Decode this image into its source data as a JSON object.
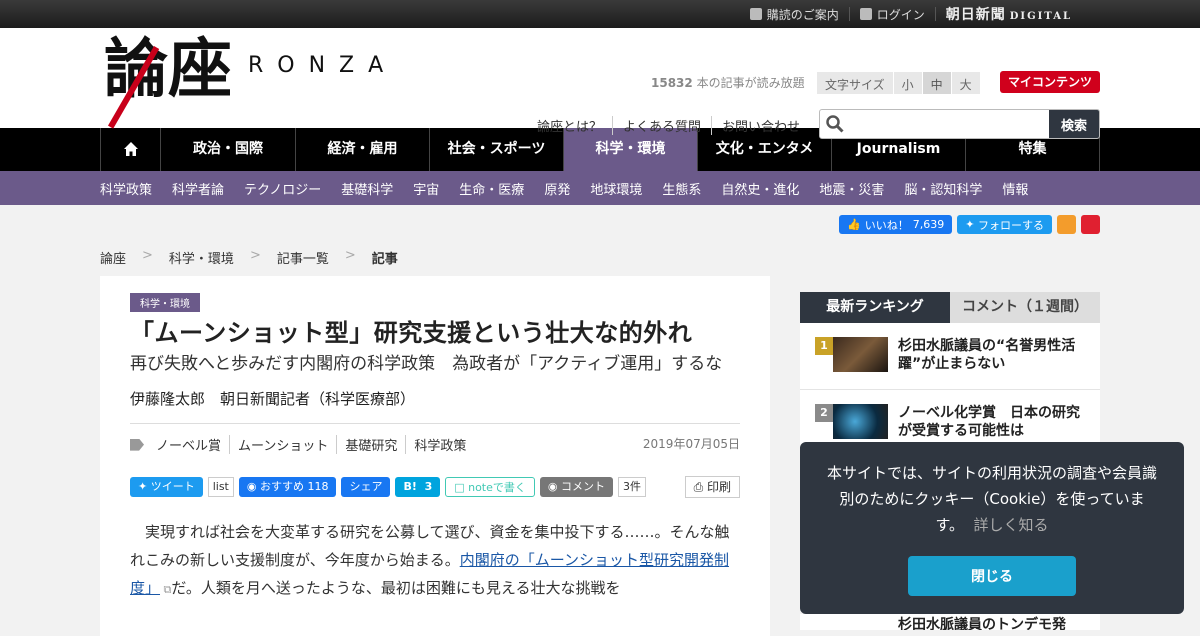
{
  "topbar": {
    "guide": "購読のご案内",
    "login": "ログイン",
    "brand": "朝日新聞",
    "brand_sub": "DIGITAL"
  },
  "header": {
    "logo_kanji": "論座",
    "logo_roman": "RONZA",
    "count_num": "15832",
    "count_text": " 本の記事が読み放題",
    "fontsize_label": "文字サイズ",
    "fontsize_small": "小",
    "fontsize_mid": "中",
    "fontsize_large": "大",
    "mycontent": "マイコンテンツ",
    "links": [
      "論座とは？",
      "よくある質問",
      "お問い合わせ"
    ],
    "search_button": "検索",
    "search_placeholder": ""
  },
  "gnav": [
    {
      "label": "",
      "icon": "home-icon"
    },
    {
      "label": "政治・国際"
    },
    {
      "label": "経済・雇用"
    },
    {
      "label": "社会・スポーツ"
    },
    {
      "label": "科学・環境",
      "active": true
    },
    {
      "label": "文化・エンタメ"
    },
    {
      "label": "Journalism"
    },
    {
      "label": "特集"
    }
  ],
  "subnav": [
    "科学政策",
    "科学者論",
    "テクノロジー",
    "基礎科学",
    "宇宙",
    "生命・医療",
    "原発",
    "地球環境",
    "生態系",
    "自然史・進化",
    "地震・災害",
    "脳・認知科学",
    "情報"
  ],
  "social": {
    "fb_like": "いいね！",
    "fb_count": "7,639",
    "tw_follow": "フォローする"
  },
  "breadcrumb": [
    "論座",
    "科学・環境",
    "記事一覧",
    "記事"
  ],
  "article": {
    "category": "科学・環境",
    "title": "「ムーンショット型」研究支援という壮大な的外れ",
    "subtitle": "再び失敗へと歩みだす内閣府の科学政策　為政者が「アクティブ運用」するな",
    "author": "伊藤隆太郎　朝日新聞記者（科学医療部）",
    "tags": [
      "ノーベル賞",
      "ムーンショット",
      "基礎研究",
      "科学政策"
    ],
    "date": "2019年07月05日",
    "share": {
      "tweet": "ツイート",
      "list": "list",
      "fb": "おすすめ",
      "fb_count": "118",
      "fb_share": "シェア",
      "hatena": "B!",
      "hatena_count": "3",
      "note": "noteで書く",
      "comment": "コメント",
      "comment_count": "3件",
      "print": "印刷"
    },
    "body_1": "実現すれば社会を大変革する研究を公募して選び、資金を集中投下する……。そんな触れこみの新しい支援制度が、今年度から始まる。",
    "body_link": "内閣府の「ムーンショット型研究開発制度」",
    "body_2": "だ。人類を月へ送ったような、最初は困難にも見える壮大な挑戦を"
  },
  "sidebar": {
    "tab_ranking": "最新ランキング",
    "tab_comment": "コメント（１週間）",
    "ranking": [
      {
        "rank": "1",
        "title": "杉田水脈議員の“名誉男性活躍”が止まらない",
        "rank_color": "#c9a227"
      },
      {
        "rank": "2",
        "title": "ノーベル化学賞　日本の研究が受賞する可能性は",
        "rank_color": "#8a8a8a"
      }
    ],
    "peek": "杉田水脈議員のトンデモ発"
  },
  "cookie": {
    "text": "本サイトでは、サイトの利用状況の調査や会員識別のためにクッキー（Cookie）を使っています。",
    "more": "詳しく知る",
    "close": "閉じる"
  }
}
